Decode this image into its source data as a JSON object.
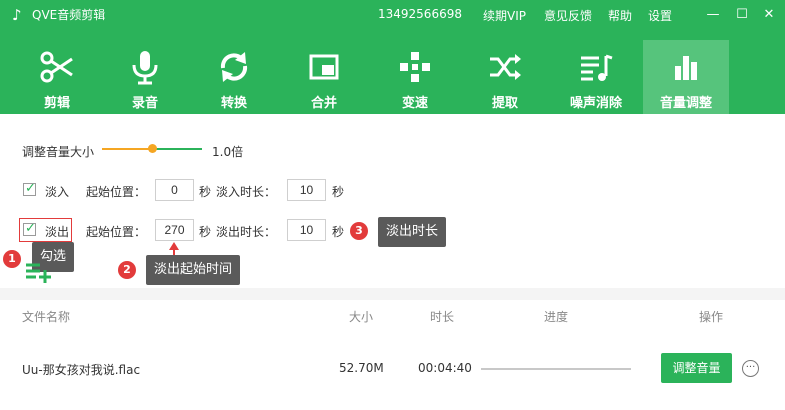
{
  "window": {
    "title": "QVE音频剪辑",
    "phone": "13492566698",
    "links": [
      "续期VIP",
      "意见反馈",
      "帮助",
      "设置"
    ],
    "controls": {
      "minimize": "—",
      "maximize": "☐",
      "close": "✕"
    },
    "bg_color": "#2bb35a"
  },
  "toolbar": {
    "items": [
      {
        "label": "剪辑",
        "icon": "scissors-icon"
      },
      {
        "label": "录音",
        "icon": "microphone-icon"
      },
      {
        "label": "转换",
        "icon": "convert-icon"
      },
      {
        "label": "合并",
        "icon": "merge-icon"
      },
      {
        "label": "变速",
        "icon": "speed-icon"
      },
      {
        "label": "提取",
        "icon": "extract-icon"
      },
      {
        "label": "噪声消除",
        "icon": "noise-icon"
      },
      {
        "label": "音量调整",
        "icon": "volume-icon"
      }
    ],
    "active_index": 7
  },
  "volume": {
    "label": "调整音量大小",
    "value_text": "1.0倍",
    "slider_fraction": 0.5
  },
  "fade_in": {
    "checked": true,
    "label": "淡入",
    "start_label": "起始位置：",
    "start_value": "0",
    "unit": "秒",
    "duration_label": "淡入时长：",
    "duration_value": "10"
  },
  "fade_out": {
    "checked": true,
    "label": "淡出",
    "start_label": "起始位置：",
    "start_value": "270",
    "unit": "秒",
    "duration_label": "淡出时长：",
    "duration_value": "10"
  },
  "annotations": [
    {
      "num": "1",
      "text": "勾选"
    },
    {
      "num": "2",
      "text": "淡出起始时间"
    },
    {
      "num": "3",
      "text": "淡出时长"
    }
  ],
  "table": {
    "headers": {
      "name": "文件名称",
      "size": "大小",
      "duration": "时长",
      "progress": "进度",
      "action": "操作"
    },
    "rows": [
      {
        "name": "Uu-那女孩对我说.flac",
        "size": "52.70M",
        "duration": "00:04:40",
        "progress": 0,
        "action_label": "调整音量",
        "more": "···"
      }
    ]
  }
}
